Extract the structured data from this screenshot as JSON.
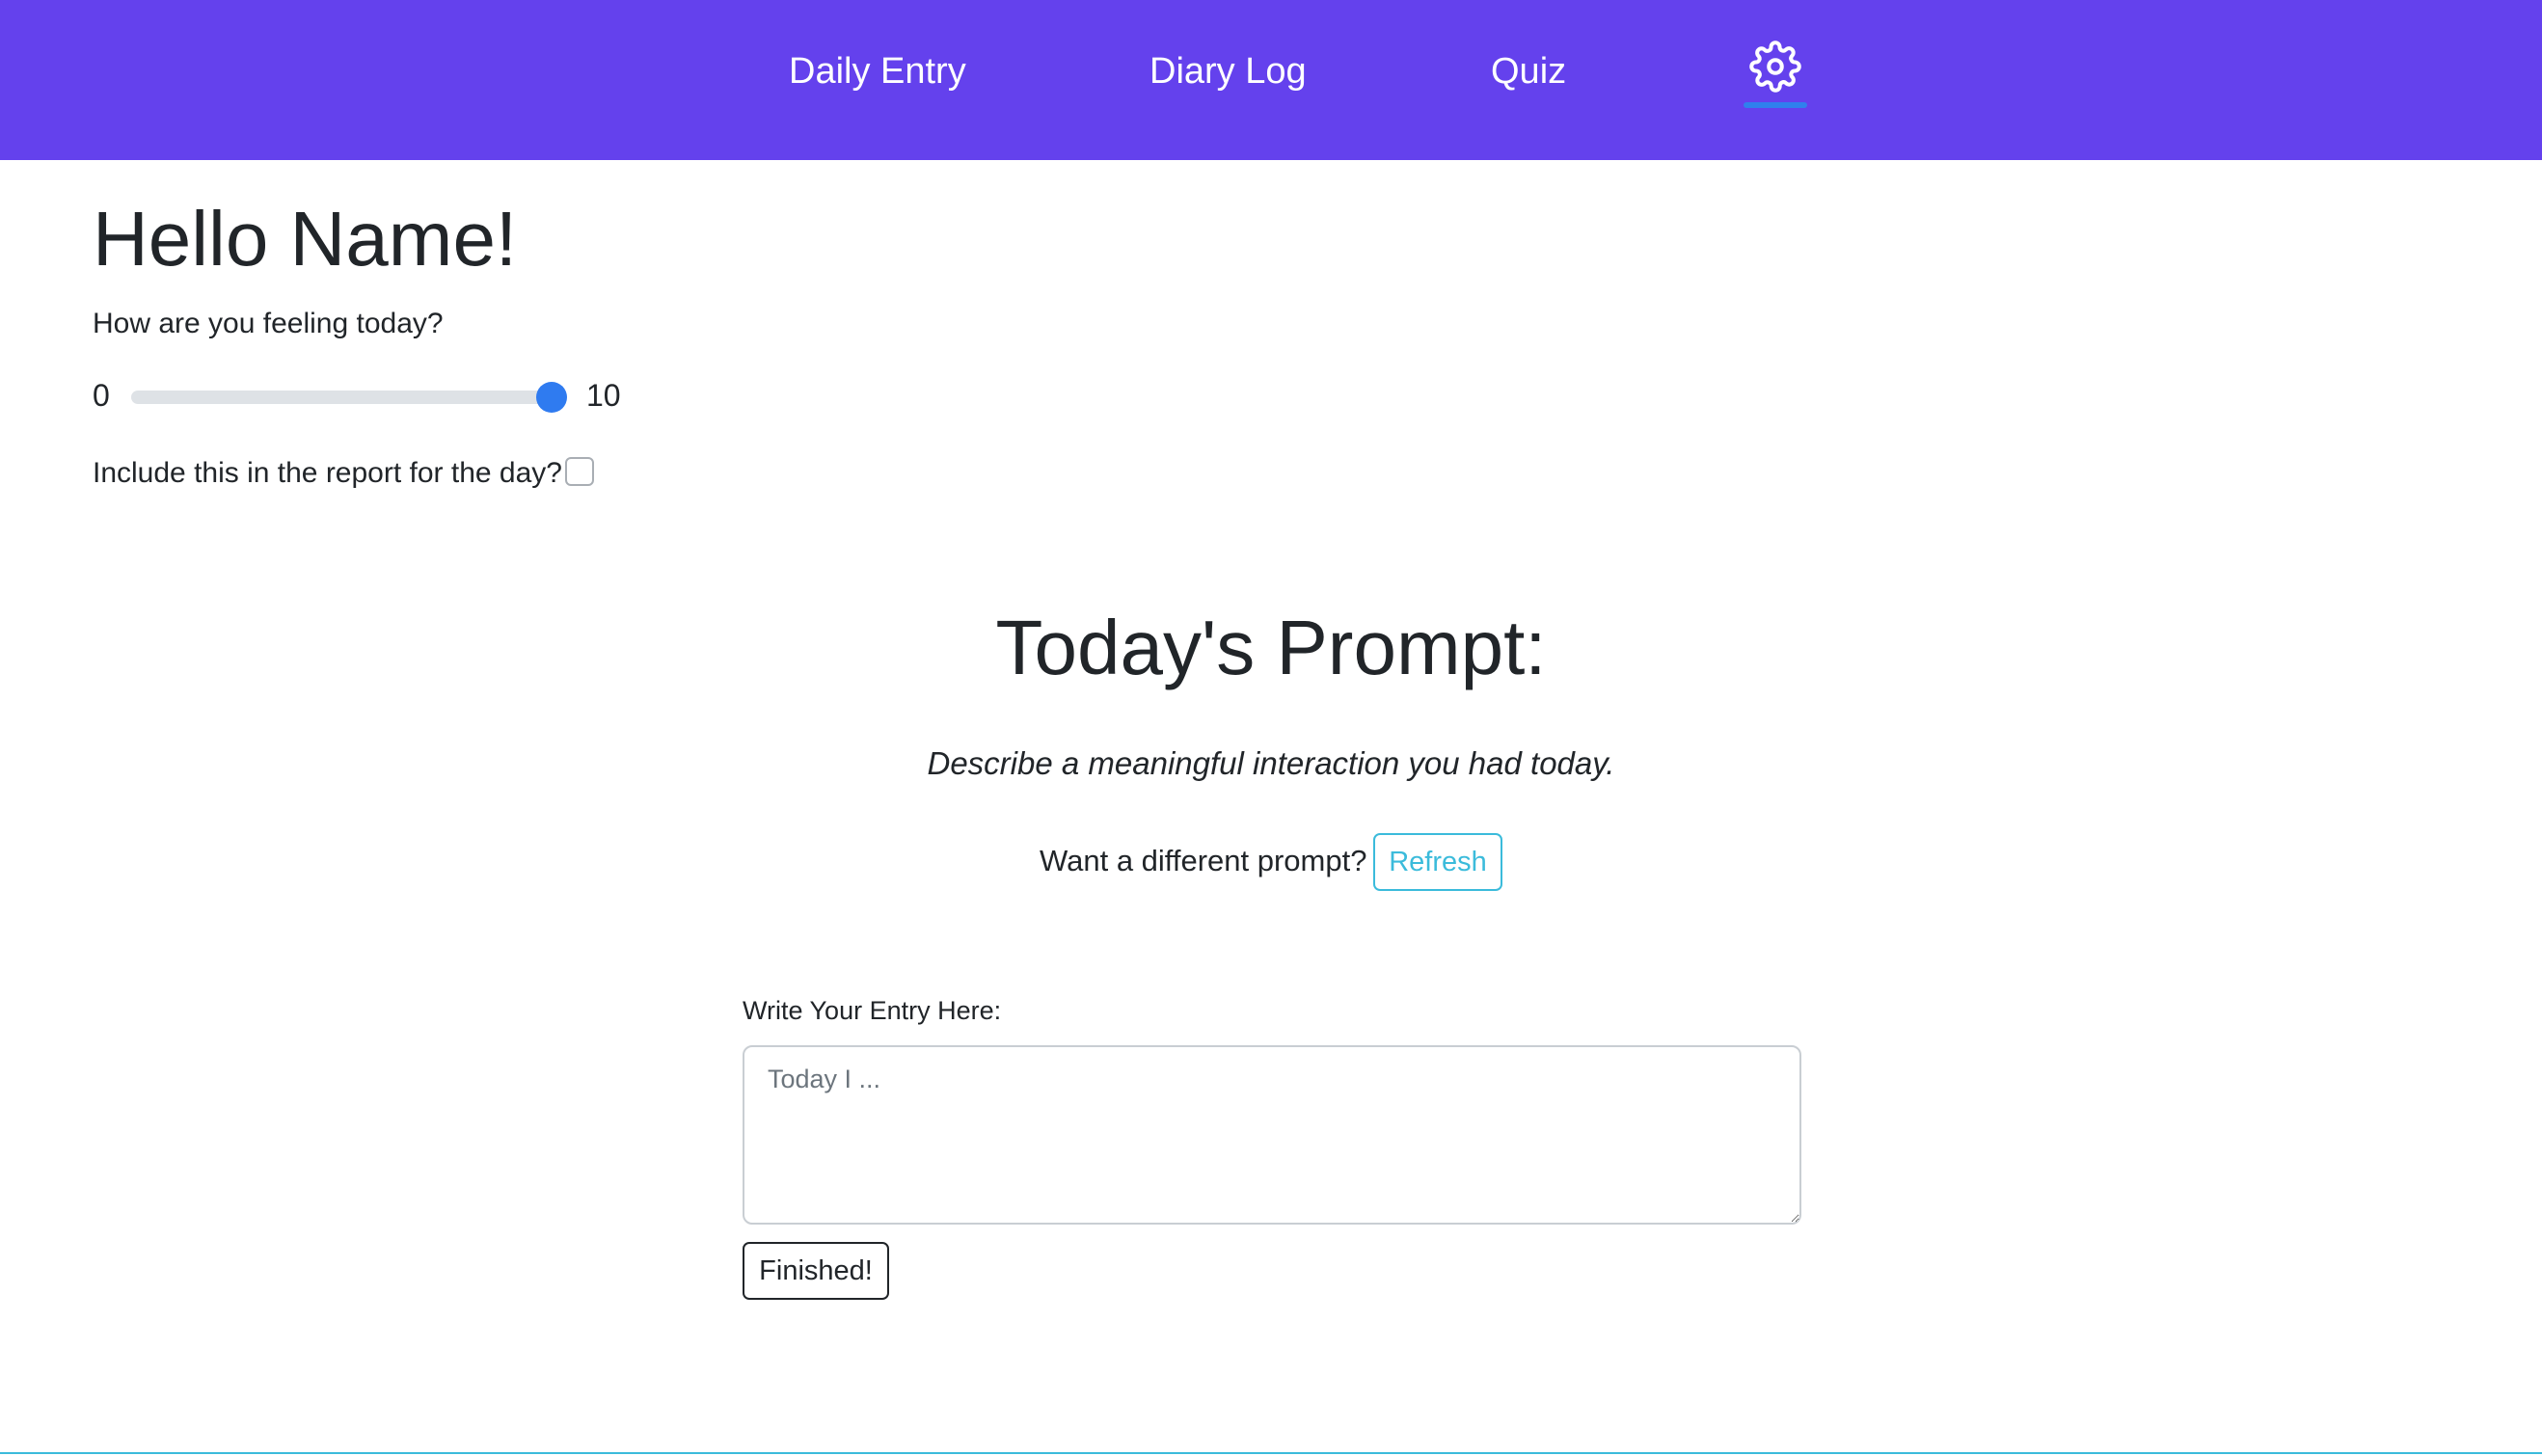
{
  "nav": {
    "items": [
      {
        "label": "Daily Entry"
      },
      {
        "label": "Diary Log"
      },
      {
        "label": "Quiz"
      }
    ],
    "settings_icon": "gear-icon",
    "background_color": "#6441ed",
    "active_indicator_color": "#2f80ed"
  },
  "mood": {
    "greeting": "Hello Name!",
    "question": "How are you feeling today?",
    "range_min": "0",
    "range_max": "10",
    "slider_value": 10,
    "slider_color": "#2f7bf0",
    "report_label": "Include this in the report for the day?",
    "report_checked": false
  },
  "prompt": {
    "heading": "Today's Prompt:",
    "text": "Describe a meaningful interaction you had today.",
    "refresh_question": "Want a different prompt?",
    "refresh_label": "Refresh",
    "refresh_color": "#3bbbdb"
  },
  "entry": {
    "label": "Write Your Entry Here:",
    "placeholder": "Today I ...",
    "value": "",
    "finish_label": "Finished!"
  }
}
